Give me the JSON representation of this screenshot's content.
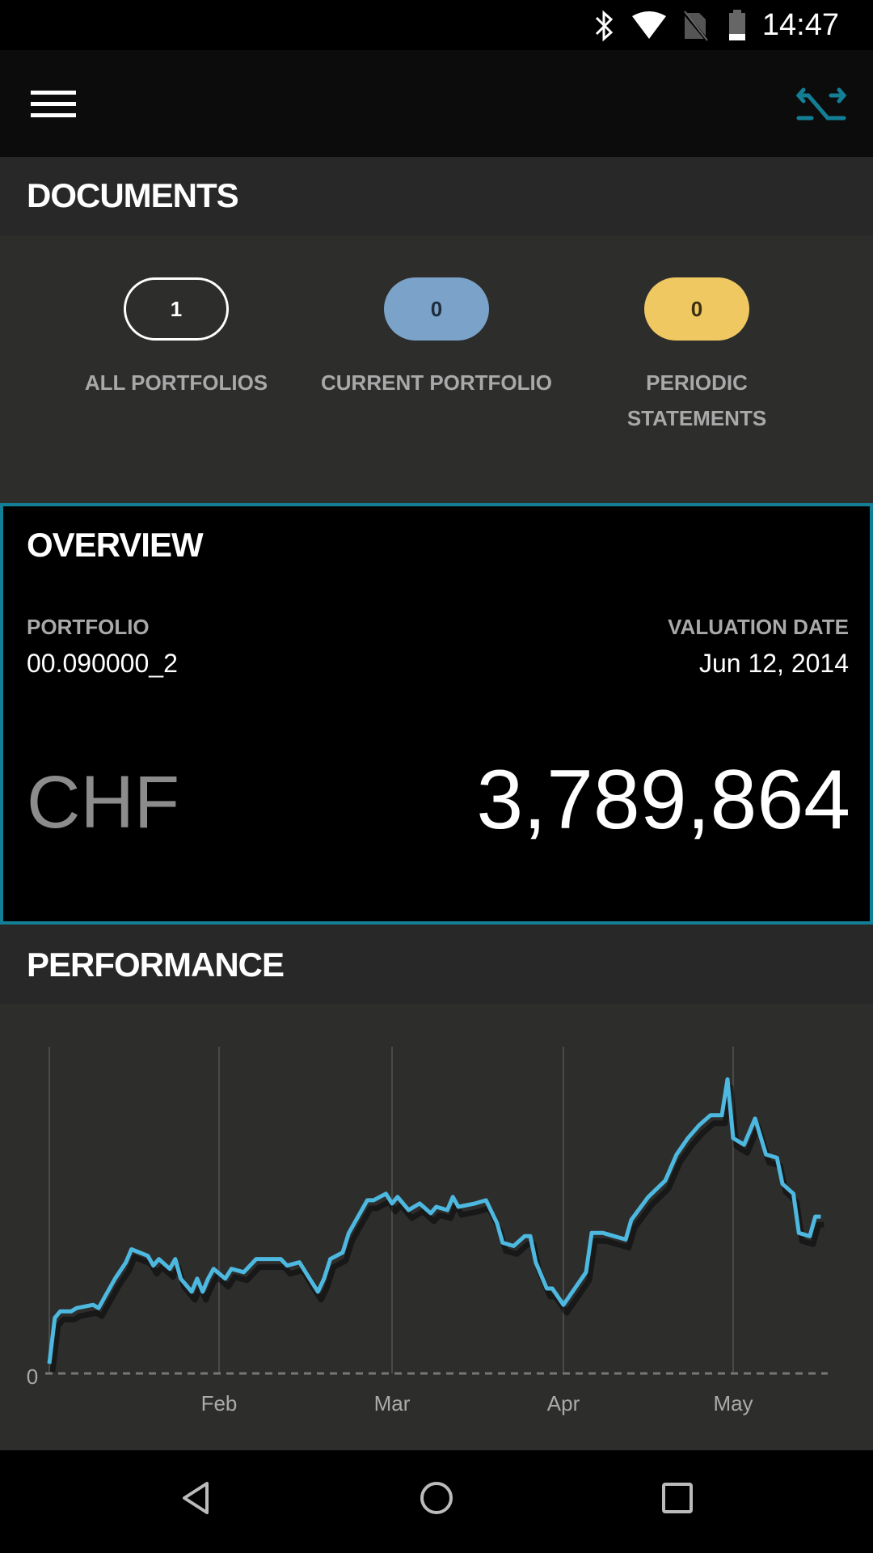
{
  "status_bar": {
    "time": "14:47",
    "icons": [
      "bluetooth-icon",
      "wifi-icon",
      "no-sim-icon",
      "battery-icon"
    ]
  },
  "header": {
    "menu_icon": "hamburger-menu-icon",
    "switch_icon": "switch-portfolio-icon",
    "accent_color": "#137f96"
  },
  "documents": {
    "title": "DOCUMENTS",
    "counters": [
      {
        "count": "1",
        "label": "ALL PORTFOLIOS",
        "color": "outline"
      },
      {
        "count": "0",
        "label": "CURRENT PORTFOLIO",
        "color": "#7ba2c9"
      },
      {
        "count": "0",
        "label_line1": "PERIODIC",
        "label_line2": "STATEMENTS",
        "color": "#efc862"
      }
    ]
  },
  "overview": {
    "title": "OVERVIEW",
    "portfolio_label": "PORTFOLIO",
    "portfolio_value": "00.090000_2",
    "valuation_label": "VALUATION DATE",
    "valuation_value": "Jun 12, 2014",
    "currency": "CHF",
    "amount": "3,789,864"
  },
  "performance": {
    "title": "PERFORMANCE"
  },
  "chart_data": {
    "type": "line",
    "line_color": "#4db9e0",
    "y_tick_labels": [
      "0"
    ],
    "x_tick_labels": [
      "Feb",
      "Mar",
      "Apr",
      "May"
    ],
    "ylim": [
      0,
      100
    ],
    "grid": "vertical",
    "points": [
      [
        "2014-01-01",
        3
      ],
      [
        "2014-01-02",
        17
      ],
      [
        "2014-01-03",
        19
      ],
      [
        "2014-01-05",
        19
      ],
      [
        "2014-01-06",
        20
      ],
      [
        "2014-01-09",
        21
      ],
      [
        "2014-01-10",
        20
      ],
      [
        "2014-01-11",
        23
      ],
      [
        "2014-01-13",
        29
      ],
      [
        "2014-01-15",
        34
      ],
      [
        "2014-01-16",
        38
      ],
      [
        "2014-01-19",
        36
      ],
      [
        "2014-01-20",
        33
      ],
      [
        "2014-01-21",
        35
      ],
      [
        "2014-01-23",
        32
      ],
      [
        "2014-01-24",
        35
      ],
      [
        "2014-01-25",
        29
      ],
      [
        "2014-01-27",
        25
      ],
      [
        "2014-01-28",
        29
      ],
      [
        "2014-01-29",
        25
      ],
      [
        "2014-01-30",
        29
      ],
      [
        "2014-01-31",
        32
      ],
      [
        "2014-02-02",
        29
      ],
      [
        "2014-02-03",
        32
      ],
      [
        "2014-02-05",
        31
      ],
      [
        "2014-02-07",
        35
      ],
      [
        "2014-02-09",
        35
      ],
      [
        "2014-02-11",
        35
      ],
      [
        "2014-02-12",
        33
      ],
      [
        "2014-02-14",
        34
      ],
      [
        "2014-02-16",
        28
      ],
      [
        "2014-02-17",
        25
      ],
      [
        "2014-02-18",
        29
      ],
      [
        "2014-02-19",
        35
      ],
      [
        "2014-02-21",
        37
      ],
      [
        "2014-02-22",
        43
      ],
      [
        "2014-02-25",
        53
      ],
      [
        "2014-02-26",
        53
      ],
      [
        "2014-02-28",
        55
      ],
      [
        "2014-03-01",
        52
      ],
      [
        "2014-03-02",
        54
      ],
      [
        "2014-03-04",
        50
      ],
      [
        "2014-03-06",
        52
      ],
      [
        "2014-03-08",
        49
      ],
      [
        "2014-03-09",
        51
      ],
      [
        "2014-03-11",
        50
      ],
      [
        "2014-03-12",
        54
      ],
      [
        "2014-03-13",
        51
      ],
      [
        "2014-03-16",
        52
      ],
      [
        "2014-03-18",
        53
      ],
      [
        "2014-03-20",
        46
      ],
      [
        "2014-03-21",
        40
      ],
      [
        "2014-03-23",
        39
      ],
      [
        "2014-03-25",
        42
      ],
      [
        "2014-03-26",
        42
      ],
      [
        "2014-03-27",
        34
      ],
      [
        "2014-03-29",
        26
      ],
      [
        "2014-03-30",
        26
      ],
      [
        "2014-04-01",
        21
      ],
      [
        "2014-04-03",
        26
      ],
      [
        "2014-04-05",
        31
      ],
      [
        "2014-04-06",
        43
      ],
      [
        "2014-04-08",
        43
      ],
      [
        "2014-04-12",
        41
      ],
      [
        "2014-04-13",
        47
      ],
      [
        "2014-04-16",
        54
      ],
      [
        "2014-04-19",
        59
      ],
      [
        "2014-04-21",
        67
      ],
      [
        "2014-04-23",
        72
      ],
      [
        "2014-04-25",
        76
      ],
      [
        "2014-04-27",
        79
      ],
      [
        "2014-04-29",
        79
      ],
      [
        "2014-04-30",
        90
      ],
      [
        "2014-05-01",
        72
      ],
      [
        "2014-05-03",
        70
      ],
      [
        "2014-05-05",
        78
      ],
      [
        "2014-05-07",
        67
      ],
      [
        "2014-05-09",
        66
      ],
      [
        "2014-05-10",
        58
      ],
      [
        "2014-05-12",
        55
      ],
      [
        "2014-05-13",
        43
      ],
      [
        "2014-05-15",
        42
      ],
      [
        "2014-05-16",
        48
      ],
      [
        "2014-05-17",
        48
      ]
    ]
  },
  "nav_bar": {
    "icons": [
      "back-icon",
      "home-icon",
      "recents-icon"
    ]
  }
}
